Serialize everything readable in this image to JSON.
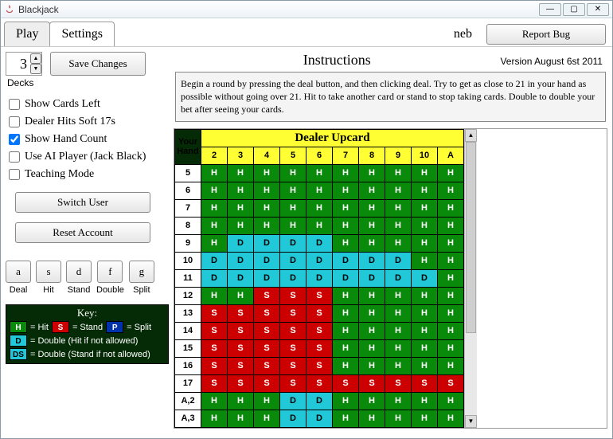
{
  "window": {
    "title": "Blackjack"
  },
  "header": {
    "tabs": [
      {
        "label": "Play",
        "active": false
      },
      {
        "label": "Settings",
        "active": true
      }
    ],
    "user": "neb",
    "report_bug": "Report Bug"
  },
  "settings": {
    "deck_count": "3",
    "save_label": "Save Changes",
    "decks_label": "Decks",
    "checks": [
      {
        "label": "Show Cards Left",
        "checked": false
      },
      {
        "label": "Dealer Hits Soft 17s",
        "checked": false
      },
      {
        "label": "Show Hand Count",
        "checked": true
      },
      {
        "label": "Use AI Player (Jack Black)",
        "checked": false
      },
      {
        "label": "Teaching Mode",
        "checked": false
      }
    ],
    "switch_user": "Switch User",
    "reset_account": "Reset Account",
    "shortcuts": [
      {
        "key": "a",
        "label": "Deal"
      },
      {
        "key": "s",
        "label": "Hit"
      },
      {
        "key": "d",
        "label": "Stand"
      },
      {
        "key": "f",
        "label": "Double"
      },
      {
        "key": "g",
        "label": "Split"
      }
    ]
  },
  "legend": {
    "title": "Key:",
    "H": "= Hit",
    "S": "= Stand",
    "P": "= Split",
    "D": "= Double (Hit if not allowed)",
    "DS": "= Double (Stand if not allowed)"
  },
  "instructions": {
    "title": "Instructions",
    "version": "Version August 6st 2011",
    "body": "Begin a round by pressing the deal button, and then clicking deal. Try to get as close to 21 in your hand as possible without going over 21. Hit to take another card or stand to stop taking cards. Double to double your bet after seeing your cards."
  },
  "chart_data": {
    "type": "table",
    "title": "Dealer Upcard",
    "row_header": "Your Hand",
    "columns": [
      "2",
      "3",
      "4",
      "5",
      "6",
      "7",
      "8",
      "9",
      "10",
      "A"
    ],
    "rows": [
      "5",
      "6",
      "7",
      "8",
      "9",
      "10",
      "11",
      "12",
      "13",
      "14",
      "15",
      "16",
      "17",
      "A,2",
      "A,3"
    ],
    "cells": [
      [
        "H",
        "H",
        "H",
        "H",
        "H",
        "H",
        "H",
        "H",
        "H",
        "H"
      ],
      [
        "H",
        "H",
        "H",
        "H",
        "H",
        "H",
        "H",
        "H",
        "H",
        "H"
      ],
      [
        "H",
        "H",
        "H",
        "H",
        "H",
        "H",
        "H",
        "H",
        "H",
        "H"
      ],
      [
        "H",
        "H",
        "H",
        "H",
        "H",
        "H",
        "H",
        "H",
        "H",
        "H"
      ],
      [
        "H",
        "D",
        "D",
        "D",
        "D",
        "H",
        "H",
        "H",
        "H",
        "H"
      ],
      [
        "D",
        "D",
        "D",
        "D",
        "D",
        "D",
        "D",
        "D",
        "H",
        "H"
      ],
      [
        "D",
        "D",
        "D",
        "D",
        "D",
        "D",
        "D",
        "D",
        "D",
        "H"
      ],
      [
        "H",
        "H",
        "S",
        "S",
        "S",
        "H",
        "H",
        "H",
        "H",
        "H"
      ],
      [
        "S",
        "S",
        "S",
        "S",
        "S",
        "H",
        "H",
        "H",
        "H",
        "H"
      ],
      [
        "S",
        "S",
        "S",
        "S",
        "S",
        "H",
        "H",
        "H",
        "H",
        "H"
      ],
      [
        "S",
        "S",
        "S",
        "S",
        "S",
        "H",
        "H",
        "H",
        "H",
        "H"
      ],
      [
        "S",
        "S",
        "S",
        "S",
        "S",
        "H",
        "H",
        "H",
        "H",
        "H"
      ],
      [
        "S",
        "S",
        "S",
        "S",
        "S",
        "S",
        "S",
        "S",
        "S",
        "S"
      ],
      [
        "H",
        "H",
        "H",
        "D",
        "D",
        "H",
        "H",
        "H",
        "H",
        "H"
      ],
      [
        "H",
        "H",
        "H",
        "D",
        "D",
        "H",
        "H",
        "H",
        "H",
        "H"
      ]
    ]
  }
}
